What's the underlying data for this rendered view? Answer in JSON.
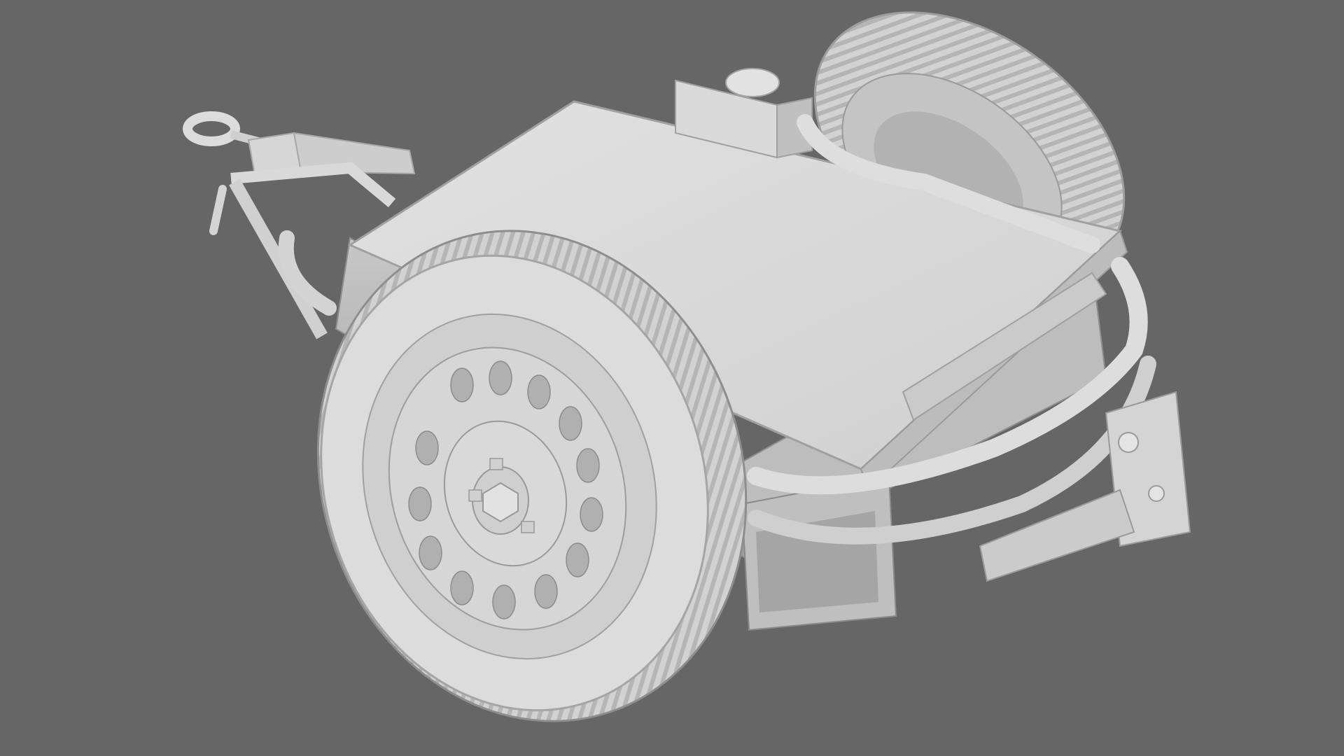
{
  "scene": {
    "subject": "trailer-clay-render",
    "background_color": "#666666",
    "model_color": "#d9d9d9",
    "shadow_color": "#9a9a9a",
    "highlight_color": "#f0f0f0"
  }
}
